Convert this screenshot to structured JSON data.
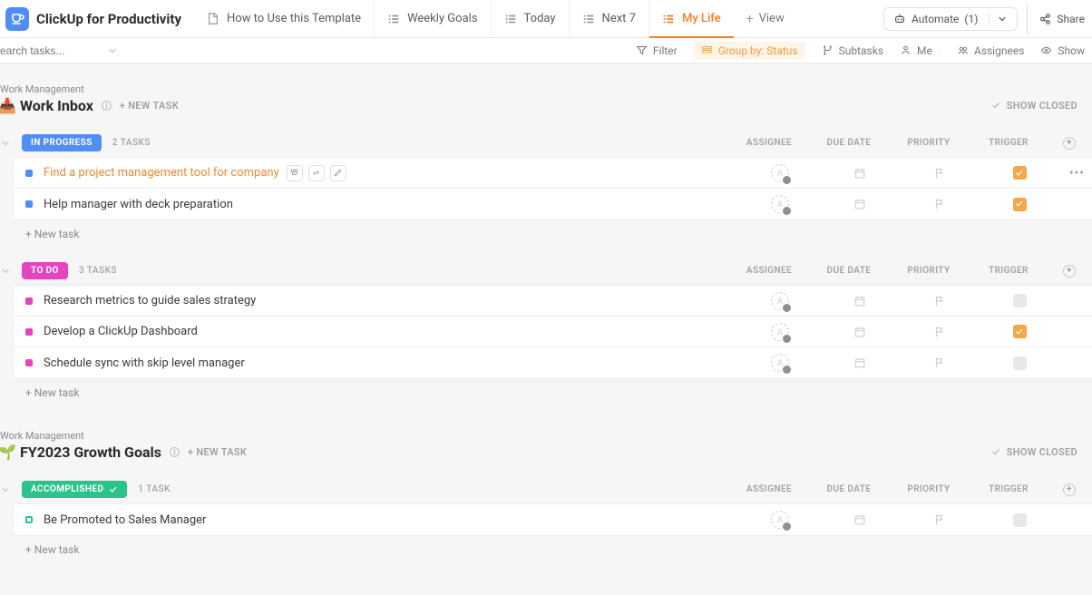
{
  "brand": {
    "title": "ClickUp for Productivity"
  },
  "views": [
    {
      "label": "How to Use this Template",
      "active": false,
      "icon": "doc"
    },
    {
      "label": "Weekly Goals",
      "active": false,
      "icon": "list"
    },
    {
      "label": "Today",
      "active": false,
      "icon": "list"
    },
    {
      "label": "Next 7",
      "active": false,
      "icon": "list"
    },
    {
      "label": "My Life",
      "active": true,
      "icon": "list"
    }
  ],
  "view_add": "View",
  "automate": {
    "label": "Automate",
    "count": "(1)"
  },
  "share": "Share",
  "search_placeholder": "earch tasks...",
  "toolbar": {
    "filter": "Filter",
    "group_by": "Group by: Status",
    "subtasks": "Subtasks",
    "me": "Me",
    "assignees": "Assignees",
    "show": "Show"
  },
  "columns": {
    "assignee": "ASSIGNEE",
    "due_date": "DUE DATE",
    "priority": "PRIORITY",
    "trigger": "TRIGGER"
  },
  "sections": [
    {
      "breadcrumb": "Work Management",
      "title": "Work Inbox",
      "icon": "inbox",
      "new_task": "+ NEW TASK",
      "show_closed": "SHOW CLOSED",
      "groups": [
        {
          "name": "IN PROGRESS",
          "kind": "progress",
          "count": "2 TASKS",
          "tasks": [
            {
              "title": "Find a project management tool for company",
              "highlight": true,
              "hover": true,
              "trigger": true,
              "more": true
            },
            {
              "title": "Help manager with deck preparation",
              "highlight": false,
              "hover": false,
              "trigger": true,
              "more": false
            }
          ],
          "add": "+ New task"
        },
        {
          "name": "TO DO",
          "kind": "todo",
          "count": "3 TASKS",
          "tasks": [
            {
              "title": "Research metrics to guide sales strategy",
              "trigger": false
            },
            {
              "title": "Develop a ClickUp Dashboard",
              "trigger": true
            },
            {
              "title": "Schedule sync with skip level manager",
              "trigger": false
            }
          ],
          "add": "+ New task"
        }
      ]
    },
    {
      "breadcrumb": "Work Management",
      "title": "FY2023 Growth Goals",
      "icon": "growth",
      "new_task": "+ NEW TASK",
      "show_closed": "SHOW CLOSED",
      "groups": [
        {
          "name": "ACCOMPLISHED",
          "kind": "accomp",
          "count": "1 TASK",
          "tasks": [
            {
              "title": "Be Promoted to Sales Manager",
              "trigger": false
            }
          ],
          "add": "+ New task"
        }
      ]
    }
  ]
}
